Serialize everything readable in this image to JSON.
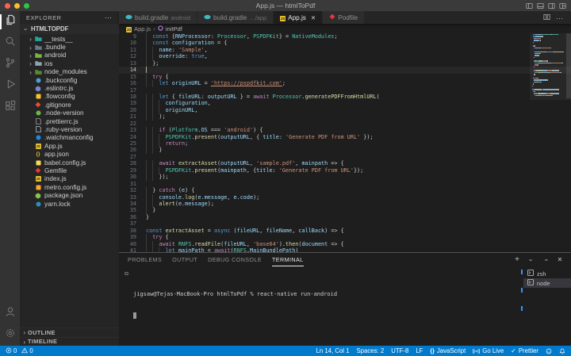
{
  "window": {
    "title": "App.js — htmlToPdf"
  },
  "colors": {
    "status_bar": "#007acc",
    "activity_bar": "#333333",
    "side_bar": "#252526",
    "editor": "#1e1e1e",
    "tab_inactive": "#2d2d2d",
    "title_bar": "#3a3a3b",
    "traffic_red": "#ff5f57",
    "traffic_yellow": "#febc2e",
    "traffic_green": "#28c840"
  },
  "title_actions": [
    "layout-sidebar-left",
    "layout-panel",
    "layout-sidebar-right",
    "layout-customize"
  ],
  "activity_bar": {
    "top": [
      {
        "name": "explorer",
        "active": true
      },
      {
        "name": "search",
        "active": false
      },
      {
        "name": "source-control",
        "active": false
      },
      {
        "name": "run-debug",
        "active": false
      },
      {
        "name": "extensions",
        "active": false
      }
    ],
    "bottom": [
      {
        "name": "accounts",
        "active": false
      },
      {
        "name": "settings",
        "active": false
      }
    ]
  },
  "explorer": {
    "header": "EXPLORER",
    "more": "⋯",
    "project": "HTMLTOPDF",
    "files": [
      {
        "label": "__tests__",
        "folder": true,
        "icon": {
          "shape": "folder",
          "color": "#26a69a"
        }
      },
      {
        "label": ".bundle",
        "folder": true,
        "icon": {
          "shape": "folder",
          "color": "#64798a"
        }
      },
      {
        "label": "android",
        "folder": true,
        "icon": {
          "shape": "folder",
          "color": "#7cb342"
        }
      },
      {
        "label": "ios",
        "folder": true,
        "icon": {
          "shape": "folder",
          "color": "#90a4ae"
        }
      },
      {
        "label": "node_modules",
        "folder": true,
        "icon": {
          "shape": "folder",
          "color": "#558b2f"
        }
      },
      {
        "label": ".buckconfig",
        "folder": false,
        "icon": {
          "shape": "circle",
          "color": "#4f9fcf"
        }
      },
      {
        "label": ".eslintrc.js",
        "folder": false,
        "icon": {
          "shape": "hex",
          "color": "#7986cb"
        }
      },
      {
        "label": ".flowconfig",
        "folder": false,
        "icon": {
          "shape": "square",
          "color": "#fbc02d"
        }
      },
      {
        "label": ".gitignore",
        "folder": false,
        "icon": {
          "shape": "diamond",
          "color": "#e84e31"
        }
      },
      {
        "label": ".node-version",
        "folder": false,
        "icon": {
          "shape": "circle",
          "color": "#66bb46"
        }
      },
      {
        "label": ".prettierrc.js",
        "folder": false,
        "icon": {
          "shape": "doc",
          "color": "#9e9e9e"
        }
      },
      {
        "label": ".ruby-version",
        "folder": false,
        "icon": {
          "shape": "doc",
          "color": "#b0bec5"
        }
      },
      {
        "label": ".watchmanconfig",
        "folder": false,
        "icon": {
          "shape": "circle",
          "color": "#1e88e5"
        }
      },
      {
        "label": "App.js",
        "folder": false,
        "icon": {
          "shape": "js",
          "color": "#e7bf33"
        }
      },
      {
        "label": "app.json",
        "folder": false,
        "icon": {
          "shape": "braces",
          "color": "#e7bf33"
        }
      },
      {
        "label": "babel.config.js",
        "folder": false,
        "icon": {
          "shape": "square",
          "color": "#f5da55"
        }
      },
      {
        "label": "Gemfile",
        "folder": false,
        "icon": {
          "shape": "diamond",
          "color": "#e53935"
        }
      },
      {
        "label": "index.js",
        "folder": false,
        "icon": {
          "shape": "js",
          "color": "#e7bf33"
        }
      },
      {
        "label": "metro.config.js",
        "folder": false,
        "icon": {
          "shape": "square",
          "color": "#ffa726"
        }
      },
      {
        "label": "package.json",
        "folder": false,
        "icon": {
          "shape": "hex",
          "color": "#8bc34a"
        }
      },
      {
        "label": "yarn.lock",
        "folder": false,
        "icon": {
          "shape": "circle",
          "color": "#2c8ebb"
        }
      }
    ],
    "sections": [
      "OUTLINE",
      "TIMELINE"
    ]
  },
  "tabs": [
    {
      "label": "build.gradle",
      "detail": "android",
      "icon": {
        "shape": "gradle",
        "color": "#3fb6c4"
      },
      "active": false,
      "close": false
    },
    {
      "label": "build.gradle",
      "detail": "…/app",
      "icon": {
        "shape": "gradle",
        "color": "#3fb6c4"
      },
      "active": false,
      "close": false
    },
    {
      "label": "App.js",
      "detail": "",
      "icon": {
        "shape": "js",
        "color": "#e7bf33"
      },
      "active": true,
      "close": true
    },
    {
      "label": "Podfile",
      "detail": "",
      "icon": {
        "shape": "diamond",
        "color": "#e0393e"
      },
      "active": false,
      "close": false
    }
  ],
  "tabbar_actions": [
    "split-editor",
    "more-actions"
  ],
  "breadcrumb": {
    "file": "App.js",
    "separator": "›",
    "symbol": "initPdf"
  },
  "editor": {
    "cursor": {
      "line": 14,
      "col": 1
    },
    "lines": [
      {
        "n": 9,
        "i": 1,
        "t": [
          [
            "kw",
            "const "
          ],
          [
            "p",
            "{"
          ],
          [
            "v",
            "RNProcessor"
          ],
          [
            "p",
            ": "
          ],
          [
            "c",
            "Processor"
          ],
          [
            "p",
            ", "
          ],
          [
            "c",
            "PSPDFKit"
          ],
          [
            "p",
            "} = "
          ],
          [
            "c",
            "NativeModules"
          ],
          [
            "p",
            ";"
          ]
        ]
      },
      {
        "n": 10,
        "i": 1,
        "t": [
          [
            "kw",
            "const "
          ],
          [
            "v",
            "configuration"
          ],
          [
            "p",
            " = {"
          ]
        ]
      },
      {
        "n": 11,
        "i": 2,
        "t": [
          [
            "v",
            "name"
          ],
          [
            "p",
            ": "
          ],
          [
            "s",
            "'Sample'"
          ],
          [
            "p",
            ","
          ]
        ]
      },
      {
        "n": 12,
        "i": 2,
        "t": [
          [
            "v",
            "override"
          ],
          [
            "p",
            ": "
          ],
          [
            "kw",
            "true"
          ],
          [
            "p",
            ","
          ]
        ]
      },
      {
        "n": 13,
        "i": 1,
        "t": [
          [
            "p",
            "};"
          ]
        ]
      },
      {
        "n": 14,
        "i": 0,
        "t": []
      },
      {
        "n": 15,
        "i": 1,
        "t": [
          [
            "ct",
            "try"
          ],
          [
            "p",
            " {"
          ]
        ]
      },
      {
        "n": 16,
        "i": 2,
        "t": [
          [
            "kw",
            "let "
          ],
          [
            "v",
            "originURL"
          ],
          [
            "p",
            " = "
          ],
          [
            "sl",
            "'https://pspdfkit.com'"
          ],
          [
            "p",
            ";"
          ]
        ]
      },
      {
        "n": 17,
        "i": 0,
        "t": []
      },
      {
        "n": 18,
        "i": 2,
        "t": [
          [
            "kw",
            "let "
          ],
          [
            "p",
            "{ "
          ],
          [
            "v",
            "fileURL"
          ],
          [
            "p",
            ": "
          ],
          [
            "v",
            "outputURL"
          ],
          [
            "p",
            " } = "
          ],
          [
            "ct",
            "await "
          ],
          [
            "c",
            "Processor"
          ],
          [
            "p",
            "."
          ],
          [
            "f",
            "generatePDFFromHtmlURL"
          ],
          [
            "p",
            "("
          ]
        ]
      },
      {
        "n": 19,
        "i": 3,
        "t": [
          [
            "v",
            "configuration"
          ],
          [
            "p",
            ","
          ]
        ]
      },
      {
        "n": 20,
        "i": 3,
        "t": [
          [
            "v",
            "originURL"
          ],
          [
            "p",
            ","
          ]
        ]
      },
      {
        "n": 21,
        "i": 2,
        "t": [
          [
            "p",
            ");"
          ]
        ]
      },
      {
        "n": 22,
        "i": 0,
        "t": []
      },
      {
        "n": 23,
        "i": 2,
        "t": [
          [
            "ct",
            "if "
          ],
          [
            "p",
            "("
          ],
          [
            "c",
            "Platform"
          ],
          [
            "p",
            "."
          ],
          [
            "v",
            "OS"
          ],
          [
            "p",
            " === "
          ],
          [
            "s",
            "'android'"
          ],
          [
            "p",
            ") {"
          ]
        ]
      },
      {
        "n": 24,
        "i": 3,
        "t": [
          [
            "c",
            "PSPDFKit"
          ],
          [
            "p",
            "."
          ],
          [
            "f",
            "present"
          ],
          [
            "p",
            "("
          ],
          [
            "v",
            "outputURL"
          ],
          [
            "p",
            ", { "
          ],
          [
            "v",
            "title"
          ],
          [
            "p",
            ": "
          ],
          [
            "s",
            "'Generate PDF from URL'"
          ],
          [
            "p",
            " });"
          ]
        ]
      },
      {
        "n": 25,
        "i": 3,
        "t": [
          [
            "ct",
            "return"
          ],
          [
            "p",
            ";"
          ]
        ]
      },
      {
        "n": 26,
        "i": 2,
        "t": [
          [
            "p",
            "}"
          ]
        ]
      },
      {
        "n": 27,
        "i": 0,
        "t": []
      },
      {
        "n": 28,
        "i": 2,
        "t": [
          [
            "ct",
            "await "
          ],
          [
            "f",
            "extractAsset"
          ],
          [
            "p",
            "("
          ],
          [
            "v",
            "outputURL"
          ],
          [
            "p",
            ", "
          ],
          [
            "s",
            "'sample.pdf'"
          ],
          [
            "p",
            ", "
          ],
          [
            "v",
            "mainpath"
          ],
          [
            "p",
            " => {"
          ]
        ]
      },
      {
        "n": 29,
        "i": 3,
        "t": [
          [
            "c",
            "PSPDFKit"
          ],
          [
            "p",
            "."
          ],
          [
            "f",
            "present"
          ],
          [
            "p",
            "("
          ],
          [
            "v",
            "mainpath"
          ],
          [
            "p",
            ", {"
          ],
          [
            "v",
            "title"
          ],
          [
            "p",
            ": "
          ],
          [
            "s",
            "'Generate PDF from URL'"
          ],
          [
            "p",
            "});"
          ]
        ]
      },
      {
        "n": 30,
        "i": 2,
        "t": [
          [
            "p",
            "});"
          ]
        ]
      },
      {
        "n": 31,
        "i": 0,
        "t": []
      },
      {
        "n": 32,
        "i": 1,
        "t": [
          [
            "p",
            "} "
          ],
          [
            "ct",
            "catch"
          ],
          [
            "p",
            " ("
          ],
          [
            "v",
            "e"
          ],
          [
            "p",
            ") {"
          ]
        ]
      },
      {
        "n": 33,
        "i": 2,
        "t": [
          [
            "v",
            "console"
          ],
          [
            "p",
            "."
          ],
          [
            "f",
            "log"
          ],
          [
            "p",
            "("
          ],
          [
            "v",
            "e"
          ],
          [
            "p",
            "."
          ],
          [
            "v",
            "message"
          ],
          [
            "p",
            ", "
          ],
          [
            "v",
            "e"
          ],
          [
            "p",
            "."
          ],
          [
            "v",
            "code"
          ],
          [
            "p",
            ");"
          ]
        ]
      },
      {
        "n": 34,
        "i": 2,
        "t": [
          [
            "f",
            "alert"
          ],
          [
            "p",
            "("
          ],
          [
            "v",
            "e"
          ],
          [
            "p",
            "."
          ],
          [
            "v",
            "message"
          ],
          [
            "p",
            ");"
          ]
        ]
      },
      {
        "n": 35,
        "i": 1,
        "t": [
          [
            "p",
            "}"
          ]
        ]
      },
      {
        "n": 36,
        "i": 0,
        "t": [
          [
            "p",
            "}"
          ]
        ]
      },
      {
        "n": 37,
        "i": 0,
        "t": []
      },
      {
        "n": 38,
        "i": 0,
        "t": [
          [
            "kw",
            "const "
          ],
          [
            "f",
            "extractAsset"
          ],
          [
            "p",
            " = "
          ],
          [
            "kw",
            "async"
          ],
          [
            "p",
            " ("
          ],
          [
            "v",
            "fileURL"
          ],
          [
            "p",
            ", "
          ],
          [
            "v",
            "fileName"
          ],
          [
            "p",
            ", "
          ],
          [
            "v",
            "callBack"
          ],
          [
            "p",
            ") => {"
          ]
        ]
      },
      {
        "n": 39,
        "i": 1,
        "t": [
          [
            "ct",
            "try"
          ],
          [
            "p",
            " {"
          ]
        ]
      },
      {
        "n": 40,
        "i": 2,
        "t": [
          [
            "ct",
            "await "
          ],
          [
            "c",
            "RNFS"
          ],
          [
            "p",
            "."
          ],
          [
            "f",
            "readFile"
          ],
          [
            "p",
            "("
          ],
          [
            "v",
            "fileURL"
          ],
          [
            "p",
            ", "
          ],
          [
            "s",
            "'base64'"
          ],
          [
            "p",
            ")."
          ],
          [
            "f",
            "then"
          ],
          [
            "p",
            "("
          ],
          [
            "v",
            "document"
          ],
          [
            "p",
            " => {"
          ]
        ]
      },
      {
        "n": 41,
        "i": 3,
        "t": [
          [
            "kw",
            "let "
          ],
          [
            "v",
            "mainPath"
          ],
          [
            "p",
            " = "
          ],
          [
            "ct",
            "await"
          ],
          [
            "p",
            "("
          ],
          [
            "c",
            "RNFS"
          ],
          [
            "p",
            "."
          ],
          [
            "v",
            "MainBundlePath"
          ],
          [
            "p",
            ")"
          ]
        ]
      }
    ]
  },
  "panel": {
    "tabs": [
      {
        "label": "PROBLEMS",
        "active": false
      },
      {
        "label": "OUTPUT",
        "active": false
      },
      {
        "label": "DEBUG CONSOLE",
        "active": false
      },
      {
        "label": "TERMINAL",
        "active": true
      }
    ],
    "actions": [
      "new-terminal",
      "terminal-picker",
      "maximize-panel",
      "close-panel"
    ],
    "terminal_line": "jigsaw@Tejas-MacBook-Pro htmlToPdf % react-native run-android",
    "terminals": [
      {
        "label": "zsh",
        "selected": false
      },
      {
        "label": "node",
        "selected": true
      }
    ]
  },
  "status_bar": {
    "errors": "0",
    "warnings": "0",
    "items": [
      {
        "icon": "",
        "label": "Ln 14, Col 1"
      },
      {
        "icon": "",
        "label": "Spaces: 2"
      },
      {
        "icon": "",
        "label": "UTF-8"
      },
      {
        "icon": "",
        "label": "LF"
      },
      {
        "icon": "braces",
        "label": "JavaScript"
      },
      {
        "icon": "broadcast",
        "label": "Go Live"
      },
      {
        "icon": "check",
        "label": "Prettier"
      },
      {
        "icon": "feedback",
        "label": ""
      },
      {
        "icon": "bell",
        "label": ""
      }
    ]
  }
}
